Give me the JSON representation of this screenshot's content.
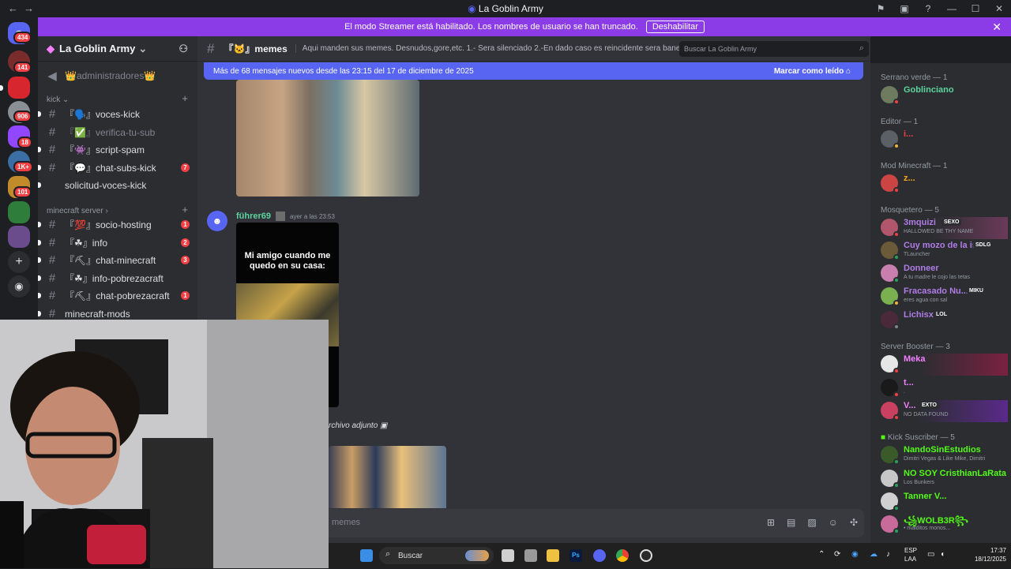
{
  "window": {
    "title": "La Goblin Army"
  },
  "banner": {
    "text": "El modo Streamer está habilitado. Los nombres de usuario se han truncado.",
    "button": "Deshabilitar"
  },
  "rail": {
    "badges": [
      "434",
      "141",
      "906",
      "18",
      "1K+",
      "101"
    ]
  },
  "sidebar": {
    "server_name": "La Goblin Army",
    "top_channel": "👑administradores👑",
    "categories": [
      {
        "name": "kick",
        "channels": [
          {
            "label": "『🗣️』voces-kick",
            "count": ""
          },
          {
            "label": "『✅』verifica-tu-sub",
            "count": ""
          },
          {
            "label": "『👾』script-spam",
            "count": ""
          },
          {
            "label": "『💬』chat-subs-kick",
            "count": "7"
          },
          {
            "label": "solicitud-voces-kick",
            "count": ""
          }
        ]
      },
      {
        "name": "minecraft server",
        "channels": [
          {
            "label": "『💯』socio-hosting",
            "count": "1"
          },
          {
            "label": "『☘』info",
            "count": "2"
          },
          {
            "label": "『⛏』chat-minecraft",
            "count": "3"
          },
          {
            "label": "『☘』info-pobrezacraft",
            "count": ""
          },
          {
            "label": "『⛏』chat-pobrezacraft",
            "count": "1"
          },
          {
            "label": "minecraft-mods",
            "count": ""
          }
        ]
      }
    ]
  },
  "chat": {
    "channel_name": "『🐱』memes",
    "topic": "Aqui manden sus memes. Desnudos,gore,etc. 1.- Sera silenciado 2.-En dado caso es reincidente sera baneado",
    "new_messages": "Más de 68 mensajes nuevos desde las 23:15 del 17 de diciembre de 2025",
    "mark_read": "Marcar como leído",
    "message": {
      "author": "führer69",
      "time": "ayer a las 23:53",
      "meme_caption": "Mi amigo cuando me quedo en su casa:"
    },
    "attachment_text": "rchivo adjunto",
    "composer_placeholder": "memes",
    "search_placeholder": "Buscar La Goblin Army"
  },
  "members": {
    "groups": [
      {
        "role": "Serrano verde — 1",
        "members": [
          {
            "name": "Goblinciano",
            "sub": "",
            "tag": "",
            "color": "#5dd39e"
          }
        ]
      },
      {
        "role": "Editor — 1",
        "members": [
          {
            "name": "i...",
            "sub": "",
            "tag": "",
            "color": "#f23f43"
          }
        ]
      },
      {
        "role": "Mod Minecraft — 1",
        "members": [
          {
            "name": "z...",
            "sub": "",
            "tag": "",
            "color": "#faa61a"
          }
        ]
      },
      {
        "role": "Mosquetero — 5",
        "members": [
          {
            "name": "3mquizi",
            "sub": "HALLOWED BE THY NAME",
            "tag": "SEXO",
            "color": "#b07ce6"
          },
          {
            "name": "Cuy mozo de la is...",
            "sub": "TLauncher",
            "tag": "SDLG",
            "color": "#b07ce6"
          },
          {
            "name": "Donneer",
            "sub": "A tu madre le cojo las tetas",
            "tag": "",
            "color": "#b07ce6"
          },
          {
            "name": "Fracasado Nu...",
            "sub": "eres agua con sal",
            "tag": "MIKU",
            "color": "#b07ce6"
          },
          {
            "name": "Lichisx",
            "sub": "",
            "tag": "LOL",
            "color": "#b07ce6"
          }
        ]
      },
      {
        "role": "Server Booster — 3",
        "members": [
          {
            "name": "Meka",
            "sub": "",
            "tag": "",
            "color": "#f47fff"
          },
          {
            "name": "t...",
            "sub": ".",
            "tag": "",
            "color": "#f47fff"
          },
          {
            "name": "V...",
            "sub": "NO DATA FOUND",
            "tag": "EXTO",
            "color": "#f47fff"
          }
        ]
      },
      {
        "role": "Kick Suscriber — 5",
        "members": [
          {
            "name": "NandoSinEstudios",
            "sub": "Dimitri Vegas & Like Mike, Dimitri",
            "tag": "",
            "color": "#53fc18"
          },
          {
            "name": "NO SOY CristhianLaRata",
            "sub": "Los Bunkers",
            "tag": "",
            "color": "#53fc18"
          },
          {
            "name": "Tanner V...",
            "sub": "",
            "tag": "",
            "color": "#53fc18"
          },
          {
            "name": "꧁WOLB3R꧂",
            "sub": "• malditos monos...",
            "tag": "",
            "color": "#53fc18"
          }
        ]
      }
    ]
  },
  "taskbar": {
    "search": "Buscar",
    "lang_top": "ESP",
    "lang_bottom": "LAA",
    "time": "17:37",
    "date": "18/12/2025"
  },
  "colors": {
    "accent": "#5865f2",
    "streamer": "#8c3ce6",
    "danger": "#f23f43"
  }
}
